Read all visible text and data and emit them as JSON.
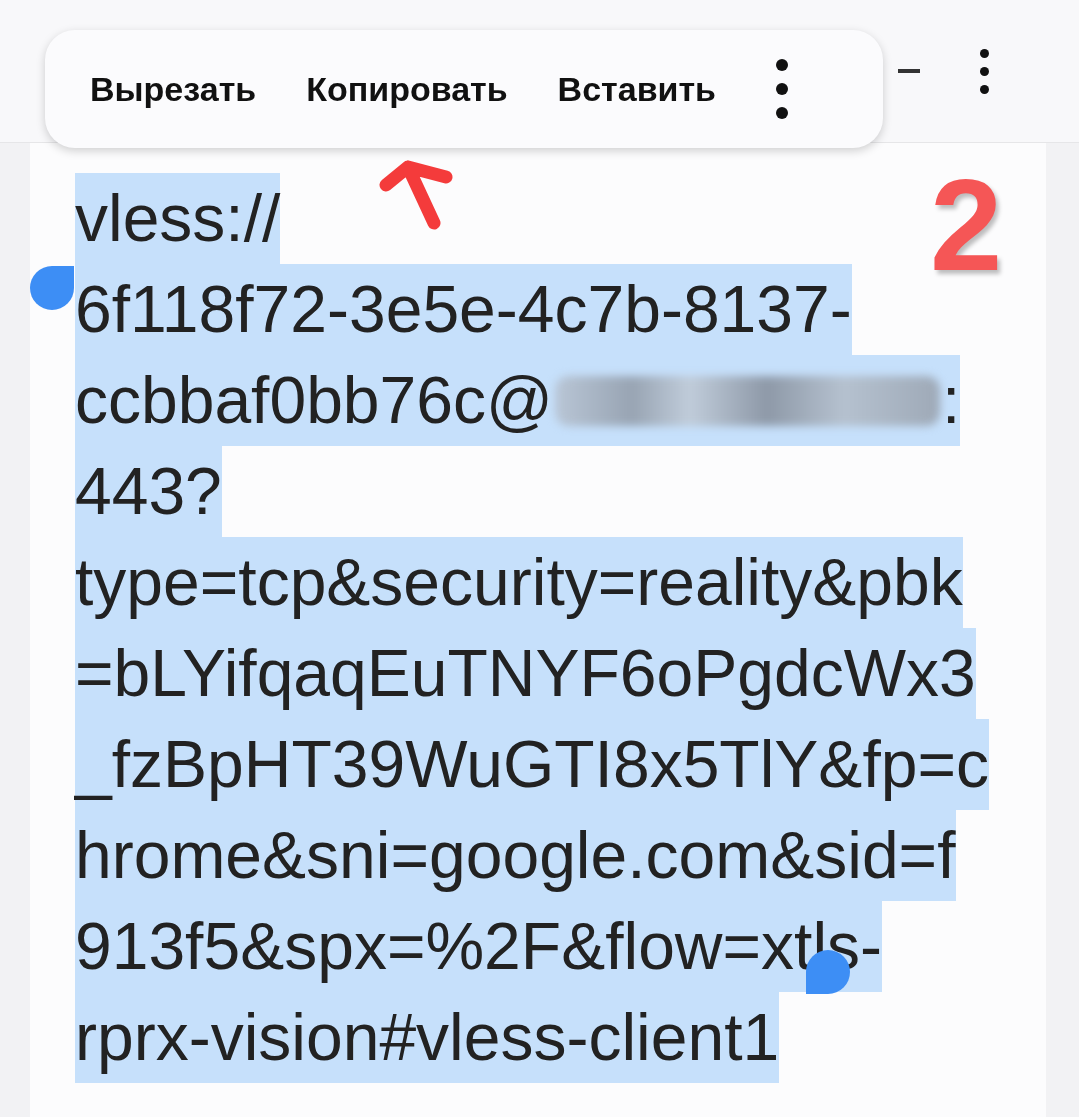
{
  "context_menu": {
    "items": [
      {
        "label": "Вырезать"
      },
      {
        "label": "Копировать"
      },
      {
        "label": "Вставить"
      }
    ]
  },
  "annotation": {
    "label": "2"
  },
  "selection": {
    "lines": [
      {
        "text": "vless://",
        "selected": true
      },
      {
        "text": "6f118f72-3e5e-4c7b-8137-",
        "selected": true
      },
      {
        "text": "ccbbaf0bb76c@",
        "redacted": true,
        "text_after": ":",
        "selected": true
      },
      {
        "text": "443?",
        "selected": true
      },
      {
        "text": "type=tcp&security=reality&pbk",
        "selected": true
      },
      {
        "text": "=bLYifqaqEuTNYF6oPgdcWx3",
        "selected": true
      },
      {
        "text": "_fzBpHT39WuGTI8x5TlY&fp=c",
        "selected": true
      },
      {
        "text": "hrome&sni=google.com&sid=f",
        "selected": true
      },
      {
        "text": "913f5&spx=%2F&flow=xtls-",
        "selected": true
      },
      {
        "text": "rprx-vision#vless-client1",
        "selected": true
      }
    ]
  }
}
